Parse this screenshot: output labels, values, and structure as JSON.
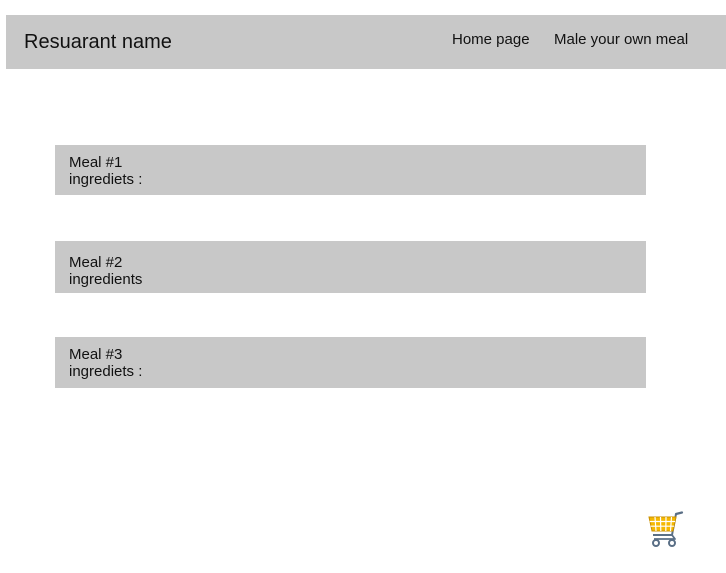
{
  "header": {
    "brand": "Resuarant name",
    "nav": [
      {
        "label": "Home page"
      },
      {
        "label": "Male your own meal"
      }
    ]
  },
  "meals": [
    {
      "title": "Meal #1",
      "ingredients": "ingrediets :"
    },
    {
      "title": "Meal #2",
      "ingredients": "ingredients"
    },
    {
      "title": "Meal #3",
      "ingredients": "ingrediets :"
    }
  ],
  "cart": {
    "icon": "shopping-cart-icon",
    "basket_color": "#f5b800",
    "frame_color": "#5a6f86"
  },
  "colors": {
    "panel": "#c8c8c8",
    "background": "#ffffff",
    "text": "#111111"
  }
}
